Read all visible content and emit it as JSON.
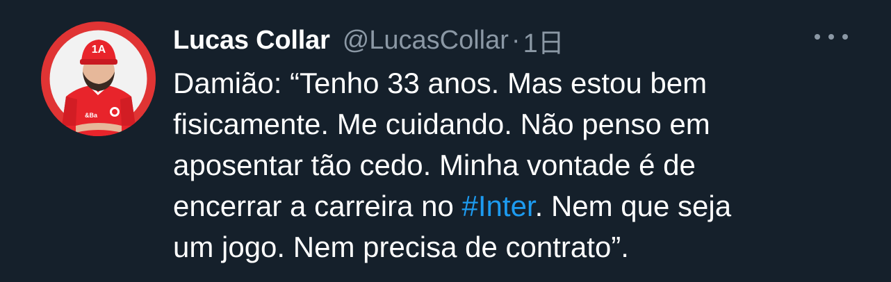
{
  "tweet": {
    "author": {
      "display_name": "Lucas Collar",
      "handle": "@LucasCollar",
      "avatar_cap_text": "1A",
      "avatar_shirt_text": "&Ba"
    },
    "separator": "·",
    "timestamp": "1日",
    "more_menu_icon": "ellipsis-icon",
    "body_lines": {
      "line1": "Damião: “Tenho 33 anos. Mas estou bem",
      "line2": "fisicamente. Me cuidando. Não penso em",
      "line3": "aposentar tão cedo. Minha vontade é de",
      "line4_before": "encerrar a carreira no ",
      "line4_hashtag": "#Inter",
      "line4_after": ". Nem que seja",
      "line5": "um jogo. Nem precisa de contrato”."
    },
    "colors": {
      "background": "#15202b",
      "text": "#ffffff",
      "secondary_text": "#8b98a5",
      "link": "#1d9bf0",
      "avatar_ring": "#e03434"
    }
  }
}
